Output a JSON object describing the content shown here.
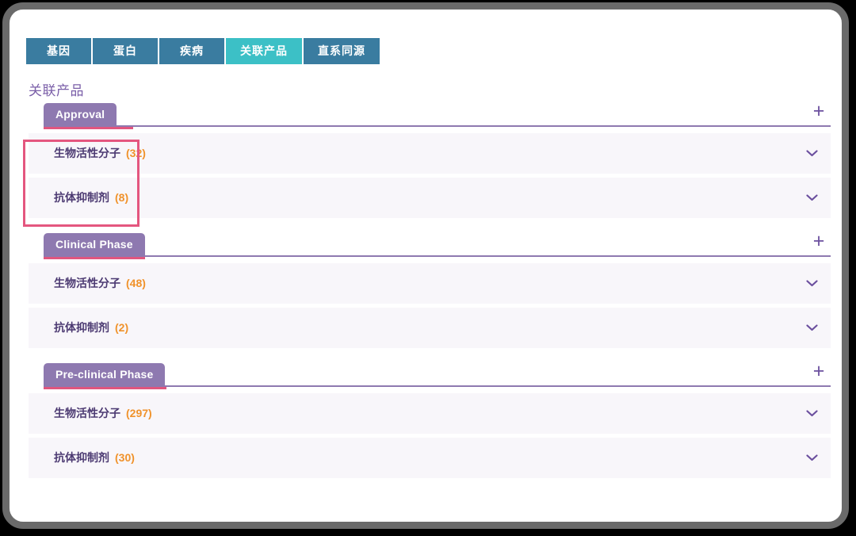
{
  "entity_tabs": [
    {
      "label": "基因",
      "active": false
    },
    {
      "label": "蛋白",
      "active": false
    },
    {
      "label": "疾病",
      "active": false
    },
    {
      "label": "关联产品",
      "active": true
    },
    {
      "label": "直系同源",
      "active": false
    }
  ],
  "section": {
    "title": "关联产品"
  },
  "icons": {
    "expand": "+",
    "chevron": "chevron-down-icon"
  },
  "colors": {
    "tab_inactive": "#3a7ca0",
    "tab_active": "#3cc0c6",
    "group_purple": "#8e79b0",
    "underline_pink": "#e0567f",
    "count_orange": "#f0922b",
    "row_bg": "#f8f6fa",
    "label_text": "#4c3a72",
    "annotation": "#e4567f"
  },
  "groups": [
    {
      "name": "Approval",
      "expand_label": "+",
      "rows": [
        {
          "label": "生物活性分子",
          "count": "(32)"
        },
        {
          "label": "抗体抑制剂",
          "count": "(8)"
        }
      ]
    },
    {
      "name": "Clinical Phase",
      "expand_label": "+",
      "rows": [
        {
          "label": "生物活性分子",
          "count": "(48)"
        },
        {
          "label": "抗体抑制剂",
          "count": "(2)"
        }
      ]
    },
    {
      "name": "Pre-clinical Phase",
      "expand_label": "+",
      "rows": [
        {
          "label": "生物活性分子",
          "count": "(297)"
        },
        {
          "label": "抗体抑制剂",
          "count": "(30)"
        }
      ]
    }
  ]
}
